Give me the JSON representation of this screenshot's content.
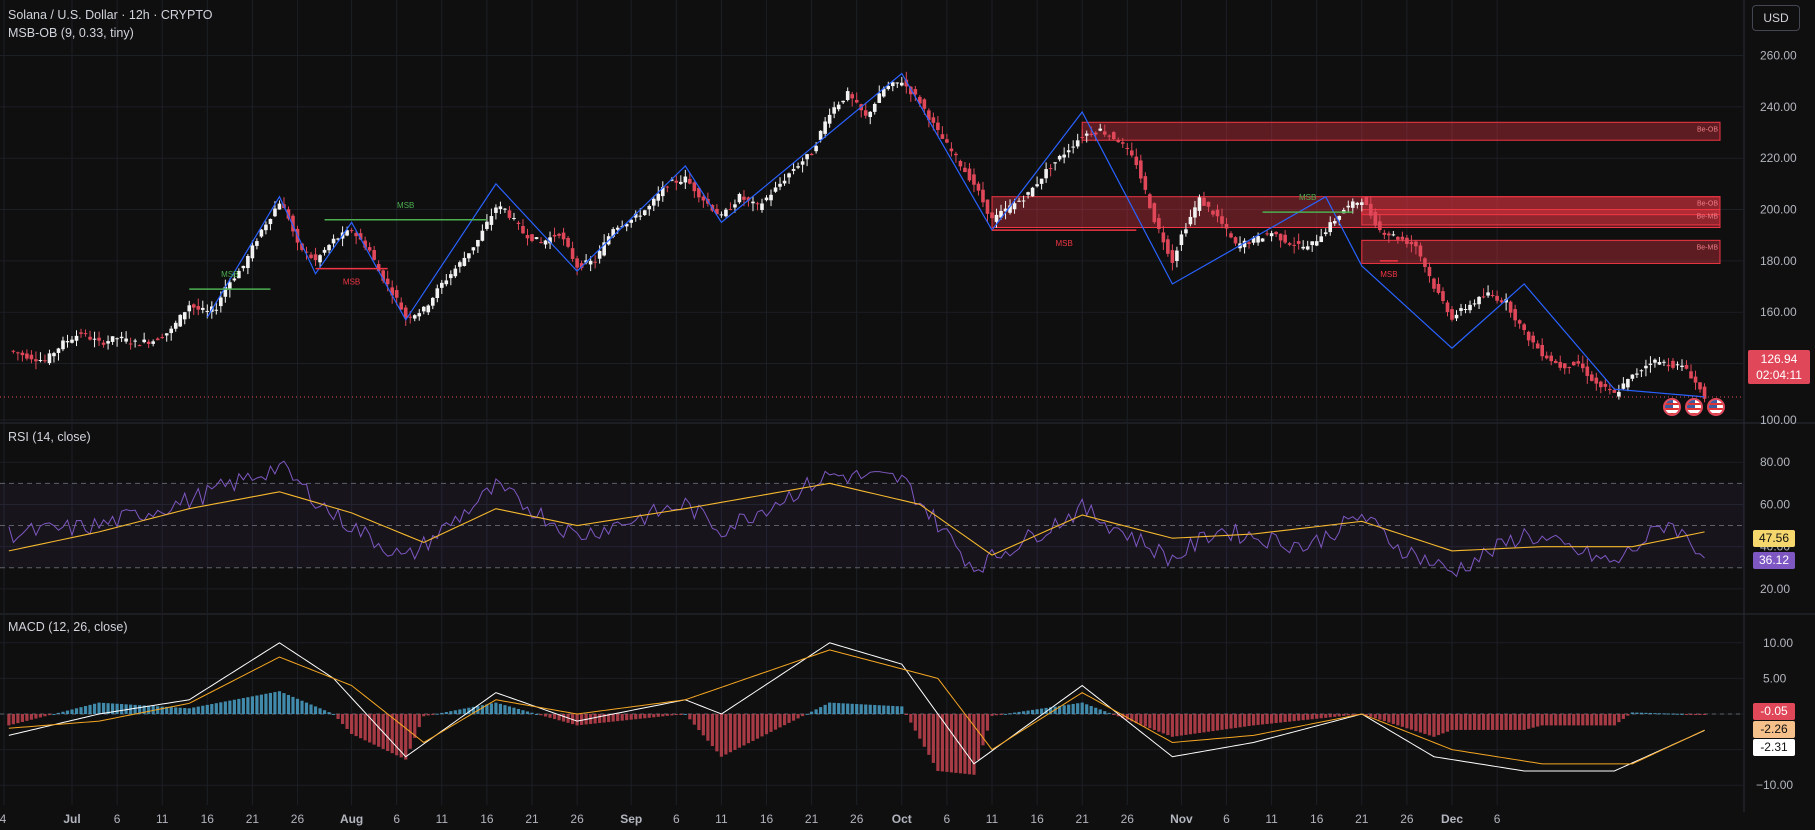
{
  "header": {
    "symbol_title": "Solana / U.S. Dollar · 12h · CRYPTO",
    "indicator_title": "MSB-OB (9, 0.33, tiny)"
  },
  "currency_button": "USD",
  "last_price": {
    "value": "126.94",
    "countdown": "02:04:11",
    "color": "#e0485a"
  },
  "rsi": {
    "title": "RSI (14, close)",
    "ma_value": "47.56",
    "rsi_value": "36.12"
  },
  "macd": {
    "title": "MACD (12, 26, close)",
    "hist_value": "-0.05",
    "signal_value": "-2.26",
    "macd_value": "-2.31"
  },
  "colors": {
    "background": "#0f0f0f",
    "up": "#f2f2f2",
    "down": "#e0485a",
    "zigzag": "#2962ff",
    "msb_bull": "#4caf50",
    "msb_bear": "#f23645",
    "rsi": "#7e57c2",
    "rsi_ma": "#f5b82e",
    "macd": "#ffffff",
    "signal": "#f5a623",
    "hist_up": "#4aa0c7",
    "hist_down": "#c2434f"
  },
  "icons": [
    "flag-us-icon"
  ],
  "chart_data": [
    {
      "type": "candlestick",
      "title": "Solana / U.S. Dollar · 12h · CRYPTO",
      "ylim": [
        118,
        268
      ],
      "y_ticks": [
        140,
        160,
        180,
        200,
        220,
        240,
        260
      ],
      "x_tick_labels": [
        "4",
        "Jul",
        "6",
        "11",
        "16",
        "21",
        "26",
        "Aug",
        "6",
        "11",
        "16",
        "21",
        "26",
        "Sep",
        "6",
        "11",
        "16",
        "21",
        "26",
        "Oct",
        "6",
        "11",
        "16",
        "21",
        "26",
        "Nov",
        "6",
        "11",
        "16",
        "21",
        "26",
        "Dec",
        "6"
      ],
      "x_tick_dates": [
        "2024-07-04",
        "2024-07-01",
        "2024-07-06",
        "2024-07-11",
        "2024-07-16",
        "2024-07-21",
        "2024-07-26",
        "2024-08-01",
        "2024-08-06",
        "2024-08-11",
        "2024-08-16",
        "2024-08-21",
        "2024-08-26",
        "2024-09-01",
        "2024-09-06",
        "2024-09-11",
        "2024-09-16",
        "2024-09-21",
        "2024-09-26",
        "2024-10-01",
        "2024-10-06",
        "2024-10-11",
        "2024-10-16",
        "2024-10-21",
        "2024-10-26",
        "2024-11-01",
        "2024-11-06",
        "2024-11-11",
        "2024-11-16",
        "2024-11-21",
        "2024-11-26",
        "2024-12-01",
        "2024-12-06"
      ],
      "close_path": [
        [
          "2024-06-24",
          145
        ],
        [
          "2024-06-26",
          143
        ],
        [
          "2024-06-28",
          141
        ],
        [
          "2024-06-30",
          148
        ],
        [
          "2024-07-02",
          152
        ],
        [
          "2024-07-04",
          148
        ],
        [
          "2024-07-06",
          150
        ],
        [
          "2024-07-08",
          148
        ],
        [
          "2024-07-10",
          149
        ],
        [
          "2024-07-12",
          153
        ],
        [
          "2024-07-13",
          158
        ],
        [
          "2024-07-14",
          163
        ],
        [
          "2024-07-15",
          161
        ],
        [
          "2024-07-16",
          160
        ],
        [
          "2024-07-17",
          162
        ],
        [
          "2024-07-18",
          170
        ],
        [
          "2024-07-20",
          178
        ],
        [
          "2024-07-22",
          192
        ],
        [
          "2024-07-24",
          203
        ],
        [
          "2024-07-25",
          197
        ],
        [
          "2024-07-26",
          186
        ],
        [
          "2024-07-28",
          180
        ],
        [
          "2024-07-30",
          188
        ],
        [
          "2024-08-01",
          192
        ],
        [
          "2024-08-03",
          184
        ],
        [
          "2024-08-04",
          176
        ],
        [
          "2024-08-06",
          165
        ],
        [
          "2024-08-07",
          158
        ],
        [
          "2024-08-09",
          161
        ],
        [
          "2024-08-11",
          171
        ],
        [
          "2024-08-13",
          179
        ],
        [
          "2024-08-15",
          188
        ],
        [
          "2024-08-17",
          201
        ],
        [
          "2024-08-18",
          200
        ],
        [
          "2024-08-20",
          191
        ],
        [
          "2024-08-22",
          187
        ],
        [
          "2024-08-24",
          191
        ],
        [
          "2024-08-26",
          178
        ],
        [
          "2024-08-28",
          180
        ],
        [
          "2024-08-30",
          193
        ],
        [
          "2024-09-01",
          196
        ],
        [
          "2024-09-03",
          201
        ],
        [
          "2024-09-05",
          210
        ],
        [
          "2024-09-07",
          212
        ],
        [
          "2024-09-09",
          204
        ],
        [
          "2024-09-11",
          197
        ],
        [
          "2024-09-13",
          205
        ],
        [
          "2024-09-15",
          201
        ],
        [
          "2024-09-17",
          208
        ],
        [
          "2024-09-19",
          216
        ],
        [
          "2024-09-21",
          222
        ],
        [
          "2024-09-23",
          238
        ],
        [
          "2024-09-25",
          245
        ],
        [
          "2024-09-27",
          236
        ],
        [
          "2024-09-29",
          247
        ],
        [
          "2024-10-01",
          250
        ],
        [
          "2024-10-03",
          242
        ],
        [
          "2024-10-05",
          230
        ],
        [
          "2024-10-07",
          220
        ],
        [
          "2024-10-09",
          210
        ],
        [
          "2024-10-11",
          196
        ],
        [
          "2024-10-13",
          201
        ],
        [
          "2024-10-15",
          206
        ],
        [
          "2024-10-17",
          215
        ],
        [
          "2024-10-19",
          222
        ],
        [
          "2024-10-21",
          229
        ],
        [
          "2024-10-23",
          231
        ],
        [
          "2024-10-25",
          227
        ],
        [
          "2024-10-27",
          218
        ],
        [
          "2024-10-29",
          196
        ],
        [
          "2024-10-31",
          180
        ],
        [
          "2024-11-01",
          190
        ],
        [
          "2024-11-03",
          204
        ],
        [
          "2024-11-05",
          197
        ],
        [
          "2024-11-07",
          186
        ],
        [
          "2024-11-09",
          188
        ],
        [
          "2024-11-11",
          191
        ],
        [
          "2024-11-13",
          187
        ],
        [
          "2024-11-15",
          185
        ],
        [
          "2024-11-17",
          192
        ],
        [
          "2024-11-19",
          200
        ],
        [
          "2024-11-21",
          204
        ],
        [
          "2024-11-23",
          192
        ],
        [
          "2024-11-25",
          189
        ],
        [
          "2024-11-27",
          186
        ],
        [
          "2024-11-29",
          170
        ],
        [
          "2024-12-01",
          158
        ],
        [
          "2024-12-03",
          163
        ],
        [
          "2024-12-05",
          167
        ],
        [
          "2024-12-07",
          164
        ],
        [
          "2024-12-09",
          152
        ],
        [
          "2024-12-11",
          144
        ],
        [
          "2024-12-13",
          139
        ],
        [
          "2024-12-15",
          140
        ],
        [
          "2024-12-17",
          132
        ],
        [
          "2024-12-19",
          128
        ],
        [
          "2024-12-21",
          135
        ],
        [
          "2024-12-23",
          141
        ],
        [
          "2024-12-25",
          140
        ],
        [
          "2024-12-27",
          138
        ],
        [
          "2024-12-29",
          127
        ]
      ],
      "zigzag_path": [
        [
          "2024-07-16",
          158
        ],
        [
          "2024-07-24",
          205
        ],
        [
          "2024-07-28",
          175
        ],
        [
          "2024-08-01",
          195
        ],
        [
          "2024-08-07",
          157
        ],
        [
          "2024-08-17",
          210
        ],
        [
          "2024-08-26",
          176
        ],
        [
          "2024-09-07",
          217
        ],
        [
          "2024-09-11",
          195
        ],
        [
          "2024-10-01",
          253
        ],
        [
          "2024-10-11",
          192
        ],
        [
          "2024-10-21",
          238
        ],
        [
          "2024-10-31",
          171
        ],
        [
          "2024-11-17",
          205
        ],
        [
          "2024-11-21",
          178
        ],
        [
          "2024-12-01",
          146
        ],
        [
          "2024-12-09",
          171
        ],
        [
          "2024-12-19",
          130
        ],
        [
          "2024-12-29",
          127
        ]
      ],
      "order_blocks": [
        {
          "label": "Be-OB",
          "from": "2024-10-21",
          "top": 234,
          "bottom": 227
        },
        {
          "label": "",
          "from": "2024-10-11",
          "top": 205,
          "bottom": 193
        },
        {
          "label": "Be-OB",
          "from": "2024-11-21",
          "top": 205,
          "bottom": 198
        },
        {
          "label": "Be-MB",
          "from": "2024-11-21",
          "top": 200,
          "bottom": 194
        },
        {
          "label": "Be-MB",
          "from": "2024-11-21",
          "top": 188,
          "bottom": 179
        }
      ],
      "annotations": [
        {
          "text": "MSB",
          "kind": "bull",
          "from": "2024-07-14",
          "to": "2024-07-23",
          "y": 169
        },
        {
          "text": "MSB",
          "kind": "bear",
          "from": "2024-07-28",
          "to": "2024-08-05",
          "y": 177
        },
        {
          "text": "MSB",
          "kind": "bull",
          "from": "2024-07-29",
          "to": "2024-08-16",
          "y": 196
        },
        {
          "text": "MSB",
          "kind": "bear",
          "from": "2024-10-11",
          "to": "2024-10-27",
          "y": 192
        },
        {
          "text": "MSB",
          "kind": "bull",
          "from": "2024-11-10",
          "to": "2024-11-20",
          "y": 199
        },
        {
          "text": "MSB",
          "kind": "bear",
          "from": "2024-11-23",
          "to": "2024-11-25",
          "y": 180
        }
      ]
    },
    {
      "type": "line",
      "title": "RSI (14, close)",
      "ylim": [
        10,
        100
      ],
      "y_ticks": [
        20,
        40,
        60,
        80,
        100
      ],
      "band": [
        30,
        70
      ],
      "series": [
        {
          "path": [
            [
              "2024-06-24",
              46
            ],
            [
              "2024-07-04",
              50
            ],
            [
              "2024-07-14",
              62
            ],
            [
              "2024-07-24",
              78
            ],
            [
              "2024-07-30",
              55
            ],
            [
              "2024-08-07",
              34
            ],
            [
              "2024-08-17",
              68
            ],
            [
              "2024-08-26",
              45
            ],
            [
              "2024-09-07",
              60
            ],
            [
              "2024-09-11",
              48
            ],
            [
              "2024-09-23",
              74
            ],
            [
              "2024-10-01",
              72
            ],
            [
              "2024-10-09",
              30
            ],
            [
              "2024-10-21",
              58
            ],
            [
              "2024-10-31",
              34
            ],
            [
              "2024-11-05",
              48
            ],
            [
              "2024-11-15",
              40
            ],
            [
              "2024-11-21",
              55
            ],
            [
              "2024-11-25",
              40
            ],
            [
              "2024-12-01",
              28
            ],
            [
              "2024-12-09",
              46
            ],
            [
              "2024-12-19",
              32
            ],
            [
              "2024-12-25",
              52
            ],
            [
              "2024-12-29",
              36
            ]
          ]
        },
        {
          "path": [
            [
              "2024-06-24",
              38
            ],
            [
              "2024-07-04",
              47
            ],
            [
              "2024-07-14",
              58
            ],
            [
              "2024-07-24",
              66
            ],
            [
              "2024-08-01",
              56
            ],
            [
              "2024-08-09",
              42
            ],
            [
              "2024-08-17",
              58
            ],
            [
              "2024-08-26",
              50
            ],
            [
              "2024-09-07",
              58
            ],
            [
              "2024-09-23",
              70
            ],
            [
              "2024-10-03",
              60
            ],
            [
              "2024-10-11",
              36
            ],
            [
              "2024-10-21",
              55
            ],
            [
              "2024-10-31",
              44
            ],
            [
              "2024-11-09",
              46
            ],
            [
              "2024-11-21",
              52
            ],
            [
              "2024-12-01",
              38
            ],
            [
              "2024-12-11",
              40
            ],
            [
              "2024-12-21",
              40
            ],
            [
              "2024-12-29",
              47
            ]
          ]
        }
      ]
    },
    {
      "type": "line",
      "title": "MACD (12, 26, close)",
      "ylim": [
        -12.5,
        12.5
      ],
      "y_ticks": [
        -10,
        5,
        10
      ],
      "series": [
        {
          "path": [
            [
              "2024-06-24",
              -3
            ],
            [
              "2024-07-04",
              0
            ],
            [
              "2024-07-14",
              2
            ],
            [
              "2024-07-24",
              10
            ],
            [
              "2024-07-30",
              5
            ],
            [
              "2024-08-07",
              -6
            ],
            [
              "2024-08-17",
              3
            ],
            [
              "2024-08-26",
              -1
            ],
            [
              "2024-09-07",
              2
            ],
            [
              "2024-09-11",
              0
            ],
            [
              "2024-09-23",
              10
            ],
            [
              "2024-10-01",
              7
            ],
            [
              "2024-10-09",
              -7
            ],
            [
              "2024-10-21",
              4
            ],
            [
              "2024-10-31",
              -6
            ],
            [
              "2024-11-09",
              -4
            ],
            [
              "2024-11-21",
              0
            ],
            [
              "2024-11-29",
              -6
            ],
            [
              "2024-12-09",
              -8
            ],
            [
              "2024-12-19",
              -8
            ],
            [
              "2024-12-29",
              -2.31
            ]
          ]
        },
        {
          "path": [
            [
              "2024-06-24",
              -2
            ],
            [
              "2024-07-04",
              -1
            ],
            [
              "2024-07-14",
              1.5
            ],
            [
              "2024-07-24",
              8
            ],
            [
              "2024-08-01",
              4
            ],
            [
              "2024-08-09",
              -4
            ],
            [
              "2024-08-17",
              2
            ],
            [
              "2024-08-26",
              0
            ],
            [
              "2024-09-07",
              2
            ],
            [
              "2024-09-23",
              9
            ],
            [
              "2024-10-05",
              5
            ],
            [
              "2024-10-11",
              -5
            ],
            [
              "2024-10-21",
              3
            ],
            [
              "2024-10-31",
              -4
            ],
            [
              "2024-11-09",
              -3
            ],
            [
              "2024-11-21",
              0
            ],
            [
              "2024-12-01",
              -5
            ],
            [
              "2024-12-11",
              -7
            ],
            [
              "2024-12-21",
              -7
            ],
            [
              "2024-12-29",
              -2.26
            ]
          ]
        }
      ]
    }
  ]
}
